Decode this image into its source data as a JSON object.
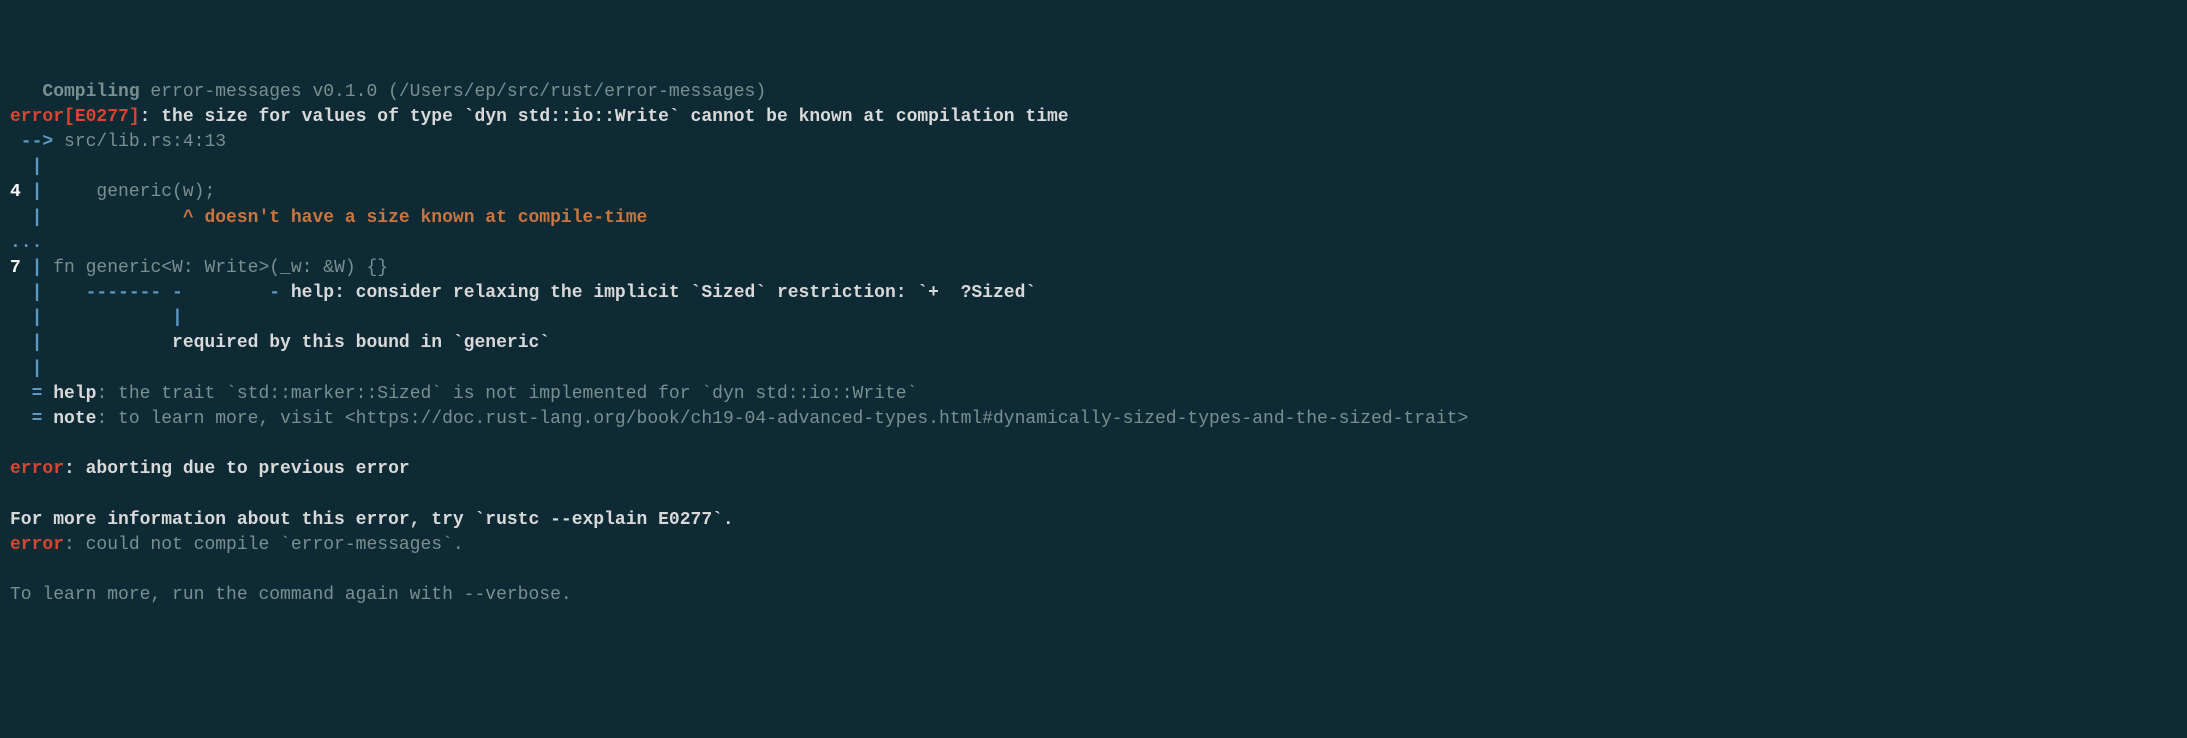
{
  "compiling": {
    "label": "   Compiling",
    "rest": " error-messages v0.1.0 (/Users/ep/src/rust/error-messages)"
  },
  "error_header": {
    "error": "error",
    "bracket_open": "[",
    "code": "E0277",
    "bracket_close": "]",
    "colon_msg": ": the size for values of type `dyn std::io::Write` cannot be known at compilation time"
  },
  "arrow": {
    "arrow": " -->",
    "loc": " src/lib.rs:4:13"
  },
  "gutter1": "  |",
  "line4": {
    "num": "4",
    "bar": " |",
    "code": "     generic(w);"
  },
  "caret": {
    "gutter": "  |",
    "spaces": "             ",
    "caret_msg": "^ doesn't have a size known at compile-time"
  },
  "dots": "...",
  "line7": {
    "num": "7",
    "bar": " |",
    "code": " fn generic<W: Write>(_w: &W) {}"
  },
  "help_line": {
    "gutter": "  |",
    "dashes": "    ------- -        ",
    "dash2": "-",
    "help": " help: consider relaxing the implicit `Sized` restriction: `+  ?Sized`"
  },
  "pipe_line": {
    "gutter": "  |",
    "spaces": "            ",
    "pipe": "|"
  },
  "required": {
    "gutter": "  |",
    "spaces": "            ",
    "msg": "required by this bound in `generic`"
  },
  "gutter2": "  |",
  "help_eq": {
    "prefix": "  = ",
    "label": "help",
    "rest": ": the trait `std::marker::Sized` is not implemented for `dyn std::io::Write`"
  },
  "note_eq": {
    "prefix": "  = ",
    "label": "note",
    "rest": ": to learn more, visit <https://doc.rust-lang.org/book/ch19-04-advanced-types.html#dynamically-sized-types-and-the-sized-trait>"
  },
  "abort": {
    "error": "error",
    "msg": ": aborting due to previous error"
  },
  "more_info": "For more information about this error, try `rustc --explain E0277`.",
  "could_not": {
    "error": "error",
    "msg": ": could not compile `error-messages`."
  },
  "learn_more": "To learn more, run the command again with --verbose."
}
